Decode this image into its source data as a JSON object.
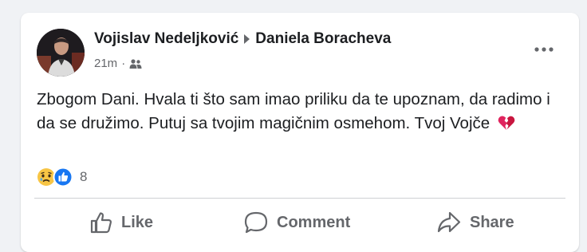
{
  "post": {
    "author": "Vojislav Nedeljković",
    "recipient": "Daniela Boracheva",
    "time": "21m",
    "dot": "·",
    "audience_icon": "friends-icon",
    "text": "Zbogom Dani. Hvala ti što sam imao priliku da te upoznam, da radimo i da se družimo. Putuj sa tvojim magičnim osmehom. Tvoj Vojče",
    "text_emoji": "broken-heart-icon"
  },
  "reactions": {
    "icons": [
      "sad-reaction-icon",
      "like-reaction-icon"
    ],
    "count": "8"
  },
  "actions": {
    "like_label": "Like",
    "comment_label": "Comment",
    "share_label": "Share"
  },
  "colors": {
    "text": "#1c1e21",
    "secondary": "#65676b",
    "like_blue": "#1877f2",
    "sad_yellow": "#f7c545",
    "heart_red": "#e0245e"
  }
}
